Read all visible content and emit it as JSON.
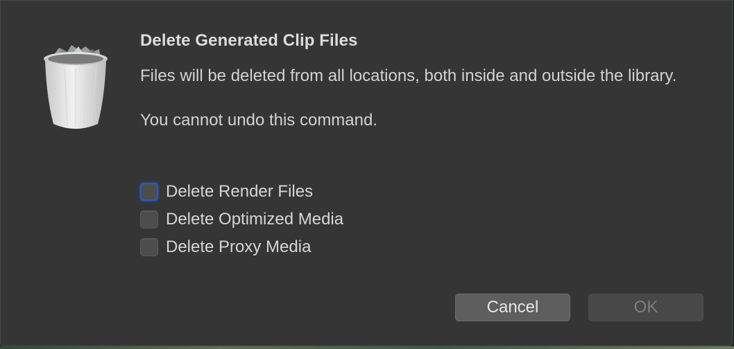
{
  "dialog": {
    "title": "Delete Generated Clip Files",
    "message_line1": "Files will be deleted from all locations, both inside and outside the library.",
    "message_line2": "You cannot undo this command.",
    "icon": "trash-icon"
  },
  "options": [
    {
      "label": "Delete Render Files",
      "checked": false,
      "focused": true
    },
    {
      "label": "Delete Optimized Media",
      "checked": false,
      "focused": false
    },
    {
      "label": "Delete Proxy Media",
      "checked": false,
      "focused": false
    }
  ],
  "buttons": {
    "cancel_label": "Cancel",
    "ok_label": "OK",
    "ok_enabled": false
  },
  "colors": {
    "dialog_bg": "#353535",
    "focus_ring": "#3a5aa8"
  }
}
